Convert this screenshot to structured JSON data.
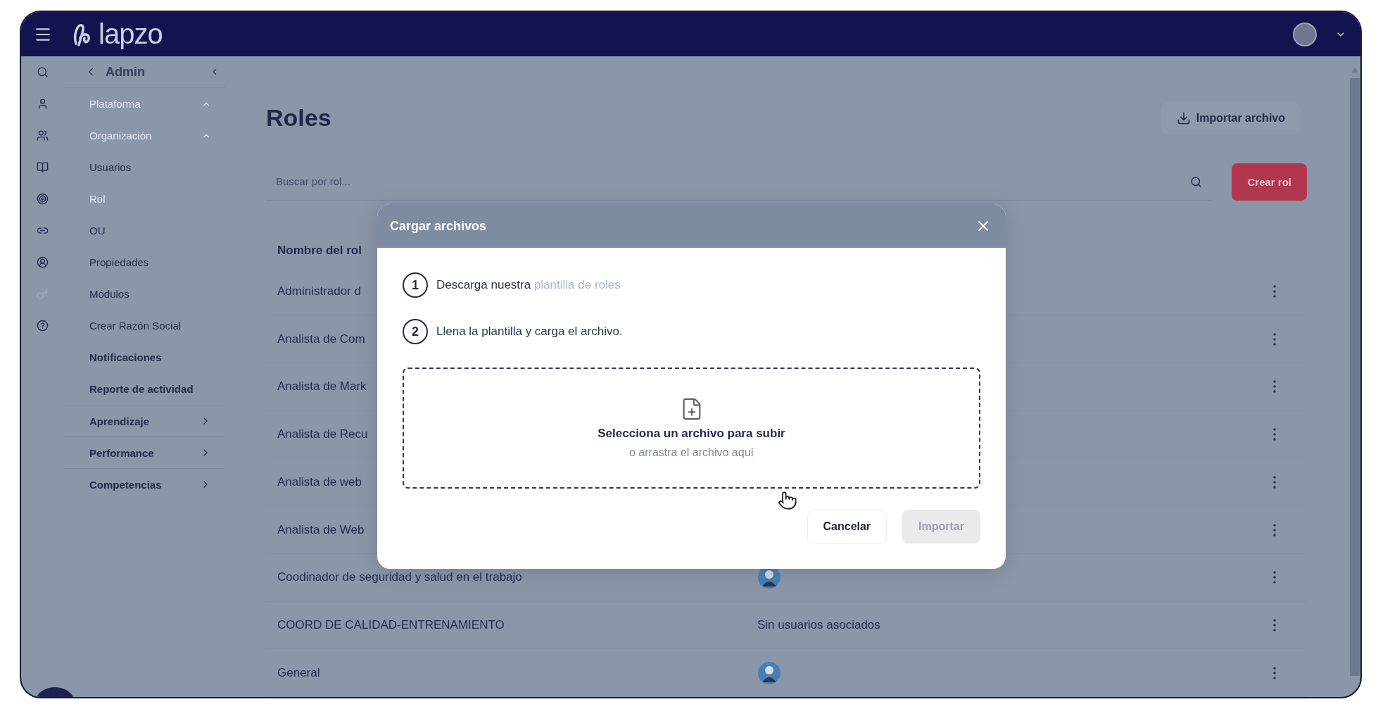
{
  "header": {
    "logo": "lapzo"
  },
  "rail": {
    "icons": [
      {
        "kind": "search",
        "faded": false
      },
      {
        "kind": "user",
        "faded": false
      },
      {
        "kind": "users",
        "faded": false
      },
      {
        "kind": "book",
        "faded": false
      },
      {
        "kind": "target",
        "faded": false
      },
      {
        "kind": "link",
        "faded": false
      },
      {
        "kind": "user-circle",
        "faded": false
      },
      {
        "kind": "key",
        "faded": true
      },
      {
        "kind": "help",
        "faded": false
      }
    ]
  },
  "sidebar": {
    "back_label": "Admin",
    "items": [
      {
        "label": "Plataforma",
        "kind": "section",
        "faded": true
      },
      {
        "label": "Organización",
        "kind": "section",
        "faded": true
      },
      {
        "label": "Usuarios",
        "kind": "link",
        "faded": false
      },
      {
        "label": "Rol",
        "kind": "link",
        "faded": true
      },
      {
        "label": "OU",
        "kind": "link",
        "faded": false
      },
      {
        "label": "Propiedades",
        "kind": "link",
        "faded": false
      },
      {
        "label": "Módulos",
        "kind": "link",
        "faded": false
      },
      {
        "label": "Crear Razón Social",
        "kind": "link",
        "faded": false
      },
      {
        "label": "Notificaciones",
        "kind": "bold",
        "faded": false
      },
      {
        "label": "Reporte de actividad",
        "kind": "bold",
        "faded": false
      },
      {
        "label": "Aprendizaje",
        "kind": "group",
        "faded": false
      },
      {
        "label": "Performance",
        "kind": "group",
        "faded": false
      },
      {
        "label": "Competencias",
        "kind": "group",
        "faded": false
      }
    ]
  },
  "page": {
    "title": "Roles",
    "import_button": "Importar archivo",
    "search": {
      "placeholder": "Buscar por rol..."
    },
    "create_button": "Crear rol"
  },
  "table": {
    "columns": [
      "Nombre del rol"
    ],
    "rows": [
      {
        "name": "Administrador d"
      },
      {
        "name": "Analista de Com"
      },
      {
        "name": "Analista de Mark"
      },
      {
        "name": "Analista de Recu"
      },
      {
        "name": "Analista de web"
      },
      {
        "name": "Analista de Web"
      },
      {
        "name": "Coodinador de seguridad y salud en el trabajo",
        "users": {
          "kind": "avatar"
        }
      },
      {
        "name": "COORD DE CALIDAD-ENTRENAMIENTO",
        "users": {
          "kind": "text",
          "text": "Sin usuarios asociados"
        }
      },
      {
        "name": "General",
        "users": {
          "kind": "avatar"
        }
      }
    ]
  },
  "modal": {
    "title": "Cargar archivos",
    "steps": [
      {
        "number": "1",
        "text": "Descarga nuestra",
        "link": "plantilla de roles"
      },
      {
        "number": "2",
        "text": "Llena la plantilla y carga el archivo."
      }
    ],
    "dropzone": {
      "title": "Selecciona un **archivo** para subir",
      "hint": "o arrastra el archivo aquí"
    },
    "buttons": [
      {
        "label": "Cancelar",
        "disabled": false
      },
      {
        "label": "Importar",
        "disabled": true
      }
    ]
  }
}
